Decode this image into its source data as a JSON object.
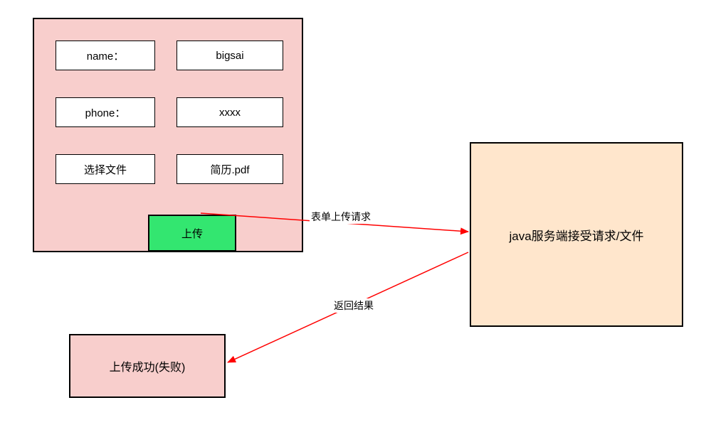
{
  "form": {
    "rows": [
      {
        "label": "name：",
        "value": "bigsai"
      },
      {
        "label": "phone：",
        "value": "xxxx"
      },
      {
        "label": "选择文件",
        "value": "简历.pdf"
      }
    ],
    "upload_button": "上传"
  },
  "server": {
    "label": "java服务端接受请求/文件"
  },
  "result": {
    "label": "上传成功(失败)"
  },
  "edges": {
    "request": "表单上传请求",
    "response": "返回结果"
  },
  "colors": {
    "form_bg": "#f8cecc",
    "server_bg": "#ffe6cc",
    "button_bg": "#33e670",
    "arrow": "#ff0000"
  }
}
